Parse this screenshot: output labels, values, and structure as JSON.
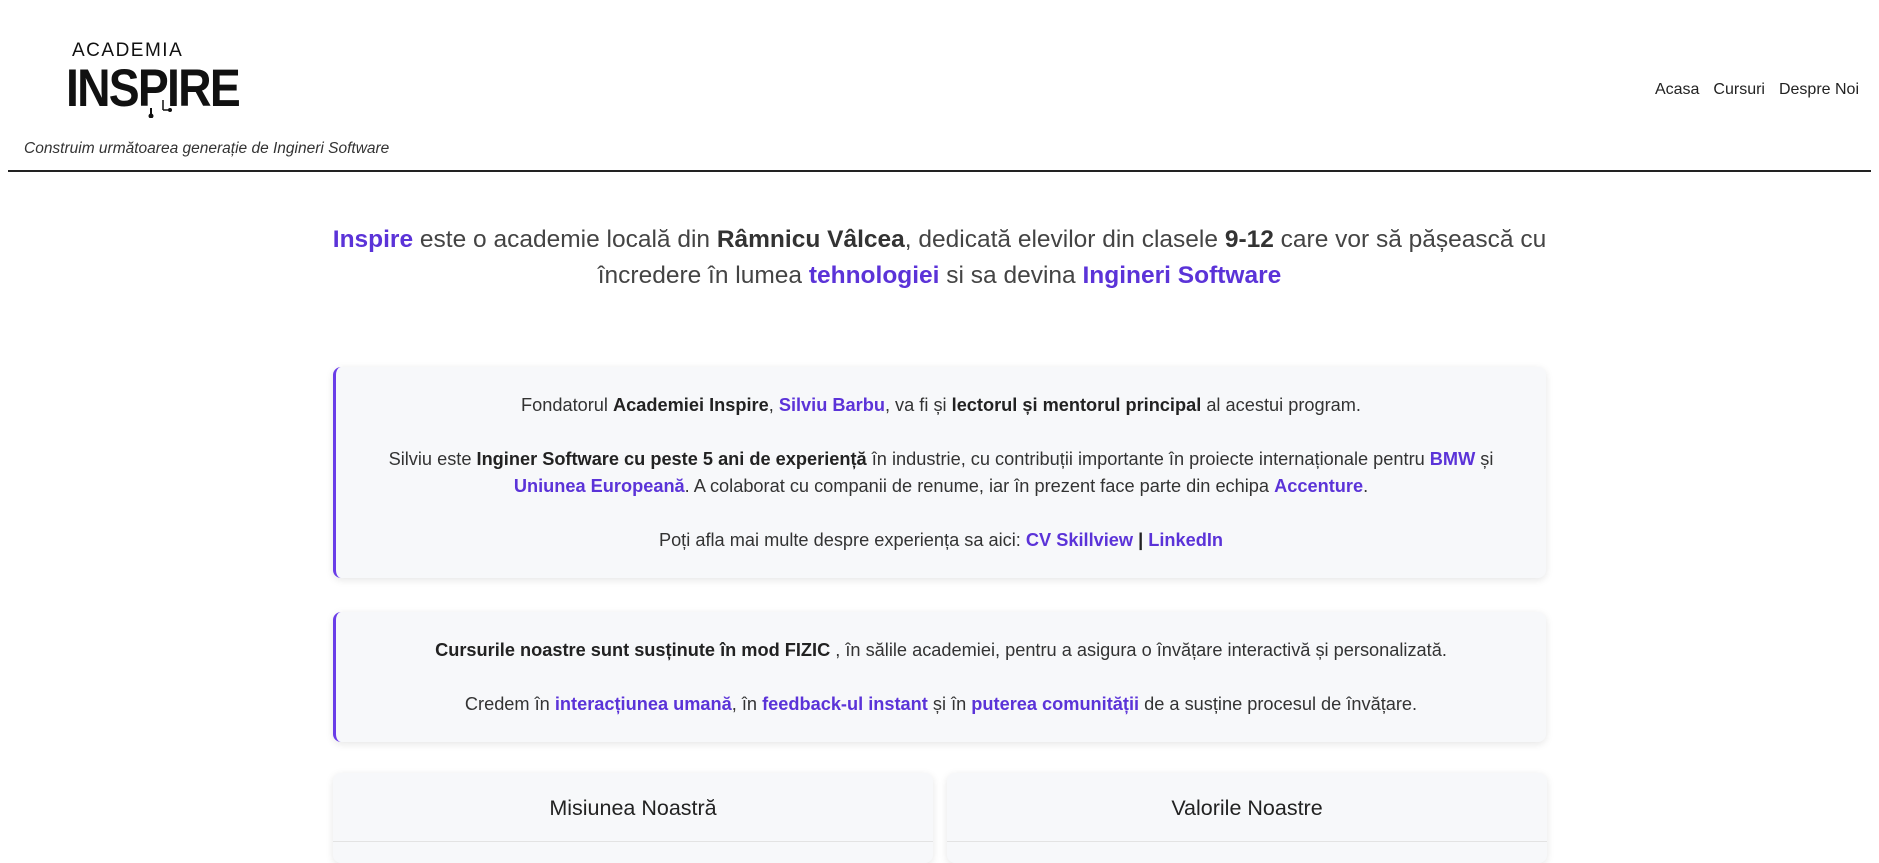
{
  "header": {
    "logo_top": "ACADEMIA",
    "logo_main": "INSPIRE",
    "tagline": "Construim următoarea generație de Ingineri Software",
    "nav": [
      "Acasa",
      "Cursuri",
      "Despre Noi"
    ]
  },
  "intro": {
    "brand": "Inspire",
    "t1": " este o academie locală din ",
    "city": "Râmnicu Vâlcea",
    "t2": ", dedicată elevilor din clasele ",
    "grades": "9-12",
    "t3": " care vor să pășească cu încredere în lumea ",
    "tech": "tehnologiei",
    "t4": " si sa devina ",
    "eng": "Ingineri Software"
  },
  "founder_card": {
    "p1_a": "Fondatorul ",
    "p1_b": "Academiei Inspire",
    "p1_c": ", ",
    "p1_name": "Silviu Barbu",
    "p1_d": ", va fi și ",
    "p1_e": "lectorul și mentorul principal",
    "p1_f": " al acestui program.",
    "p2_a": "Silviu este ",
    "p2_b": "Inginer Software cu peste 5 ani de experiență",
    "p2_c": " în industrie, cu contribuții importante în proiecte internaționale pentru ",
    "p2_bmw": "BMW",
    "p2_d": " și ",
    "p2_eu": "Uniunea Europeană",
    "p2_e": ". A colaborat cu companii de renume, iar în prezent face parte din echipa ",
    "p2_acc": "Accenture",
    "p2_f": ".",
    "p3_a": "Poți afla mai multe despre experiența sa aici: ",
    "p3_cv": "CV Skillview",
    "p3_sep": " | ",
    "p3_li": "LinkedIn"
  },
  "courses_card": {
    "p1_a": "Cursurile noastre sunt susținute în mod FIZIC",
    "p1_b": " , în sălile academiei, pentru a asigura o învățare interactivă și personalizată.",
    "p2_a": "Credem în ",
    "p2_b": "interacțiunea umană",
    "p2_c": ", în ",
    "p2_d": "feedback-ul instant",
    "p2_e": " și în ",
    "p2_f": "puterea comunității",
    "p2_g": " de a susține procesul de învățare."
  },
  "sections": {
    "mission": "Misiunea Noastră",
    "values": "Valorile Noastre"
  },
  "colors": {
    "accent": "#5b33d8",
    "card_border": "#6a3de8",
    "card_bg": "#f7f8fa"
  }
}
